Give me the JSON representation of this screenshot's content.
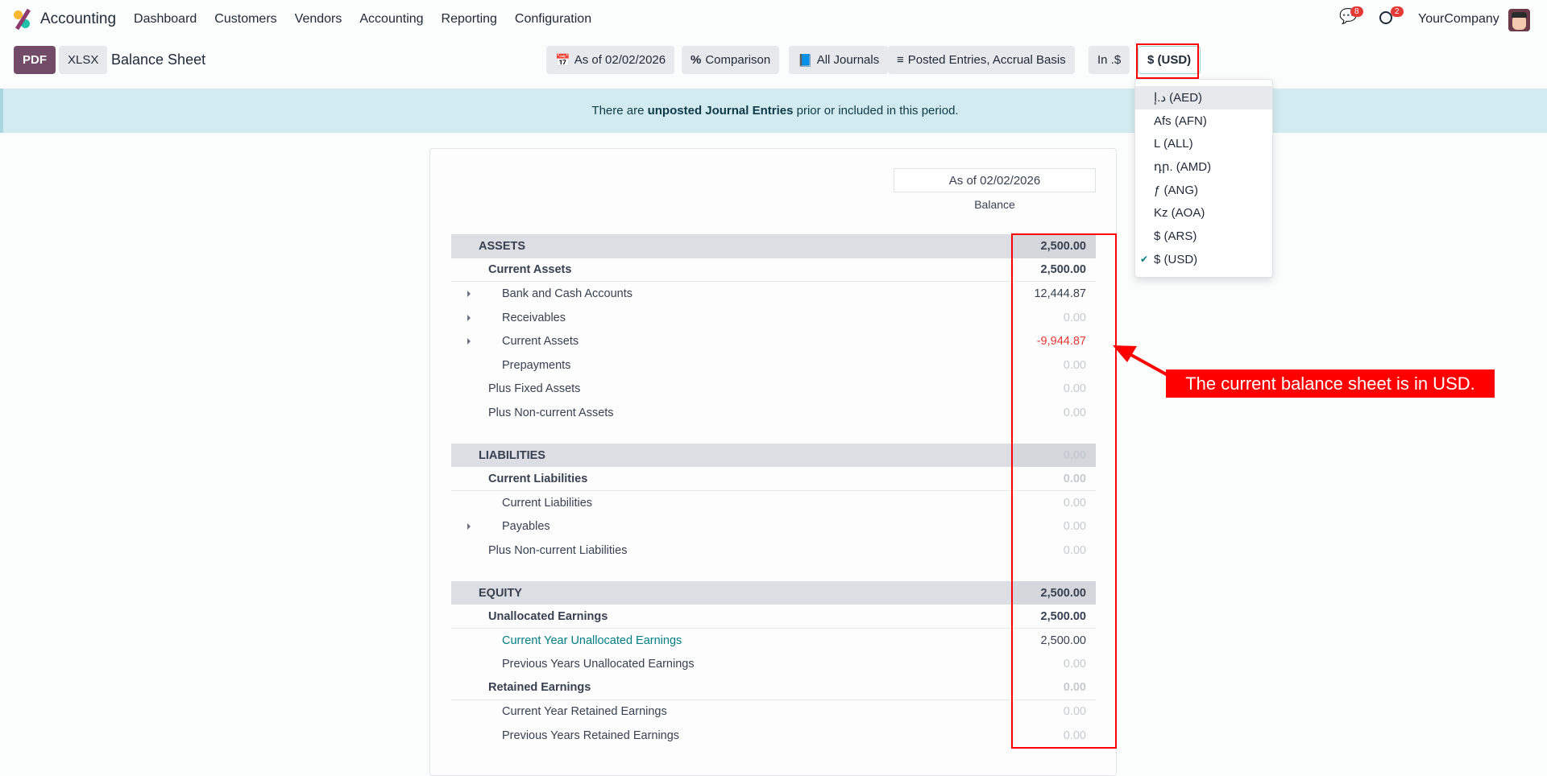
{
  "nav": {
    "app": "Accounting",
    "menus": [
      "Dashboard",
      "Customers",
      "Vendors",
      "Accounting",
      "Reporting",
      "Configuration"
    ],
    "messages_count": "8",
    "activities_count": "2",
    "company": "YourCompany"
  },
  "toolbar": {
    "pdf": "PDF",
    "xlsx": "XLSX",
    "title": "Balance Sheet",
    "date_filter": "As of 02/02/2026",
    "comparison": "Comparison",
    "journals": "All Journals",
    "entries": "Posted Entries, Accrual Basis",
    "in_currency": "In .$",
    "currency": "$ (USD)"
  },
  "alert": {
    "pre": "There are ",
    "bold": "unposted Journal Entries",
    "post": " prior or included in this period."
  },
  "report": {
    "column_date": "As of 02/02/2026",
    "column_label": "Balance",
    "rows": [
      {
        "type": "section",
        "label": "ASSETS",
        "amount": "2,500.00"
      },
      {
        "type": "group",
        "label": "Current Assets",
        "amount": "2,500.00"
      },
      {
        "type": "line",
        "label": "Bank and Cash Accounts",
        "amount": "12,444.87",
        "caret": true
      },
      {
        "type": "line",
        "label": "Receivables",
        "amount": "0.00",
        "caret": true,
        "style": "zero"
      },
      {
        "type": "line",
        "label": "Current Assets",
        "amount": "-9,944.87",
        "caret": true,
        "style": "neg"
      },
      {
        "type": "line",
        "label": "Prepayments",
        "amount": "0.00",
        "style": "zero"
      },
      {
        "type": "plain",
        "label": "Plus Fixed Assets",
        "amount": "0.00",
        "style": "zero"
      },
      {
        "type": "plain",
        "label": "Plus Non-current Assets",
        "amount": "0.00",
        "style": "zero"
      },
      {
        "type": "spacer"
      },
      {
        "type": "section",
        "label": "LIABILITIES",
        "amount": "0.00",
        "style": "zero"
      },
      {
        "type": "group",
        "label": "Current Liabilities",
        "amount": "0.00",
        "style": "zero"
      },
      {
        "type": "line",
        "label": "Current Liabilities",
        "amount": "0.00",
        "style": "zero"
      },
      {
        "type": "line",
        "label": "Payables",
        "amount": "0.00",
        "caret": true,
        "style": "zero"
      },
      {
        "type": "plain",
        "label": "Plus Non-current Liabilities",
        "amount": "0.00",
        "style": "zero"
      },
      {
        "type": "spacer"
      },
      {
        "type": "section",
        "label": "EQUITY",
        "amount": "2,500.00"
      },
      {
        "type": "group",
        "label": "Unallocated Earnings",
        "amount": "2,500.00"
      },
      {
        "type": "line",
        "label": "Current Year Unallocated Earnings",
        "amount": "2,500.00",
        "link": true
      },
      {
        "type": "line",
        "label": "Previous Years Unallocated Earnings",
        "amount": "0.00",
        "style": "zero"
      },
      {
        "type": "group",
        "label": "Retained Earnings",
        "amount": "0.00",
        "style": "zero"
      },
      {
        "type": "line",
        "label": "Current Year Retained Earnings",
        "amount": "0.00",
        "style": "zero"
      },
      {
        "type": "line",
        "label": "Previous Years Retained Earnings",
        "amount": "0.00",
        "style": "zero"
      }
    ]
  },
  "currency_dropdown": {
    "options": [
      "د.إ (AED)",
      "Afs (AFN)",
      "L (ALL)",
      "դր. (AMD)",
      "ƒ (ANG)",
      "Kz (AOA)",
      "$ (ARS)",
      "$ (USD)"
    ],
    "selected": "$ (USD)"
  },
  "annotation": {
    "text": "The current balance sheet is in USD.",
    "color": "#ff0000"
  }
}
